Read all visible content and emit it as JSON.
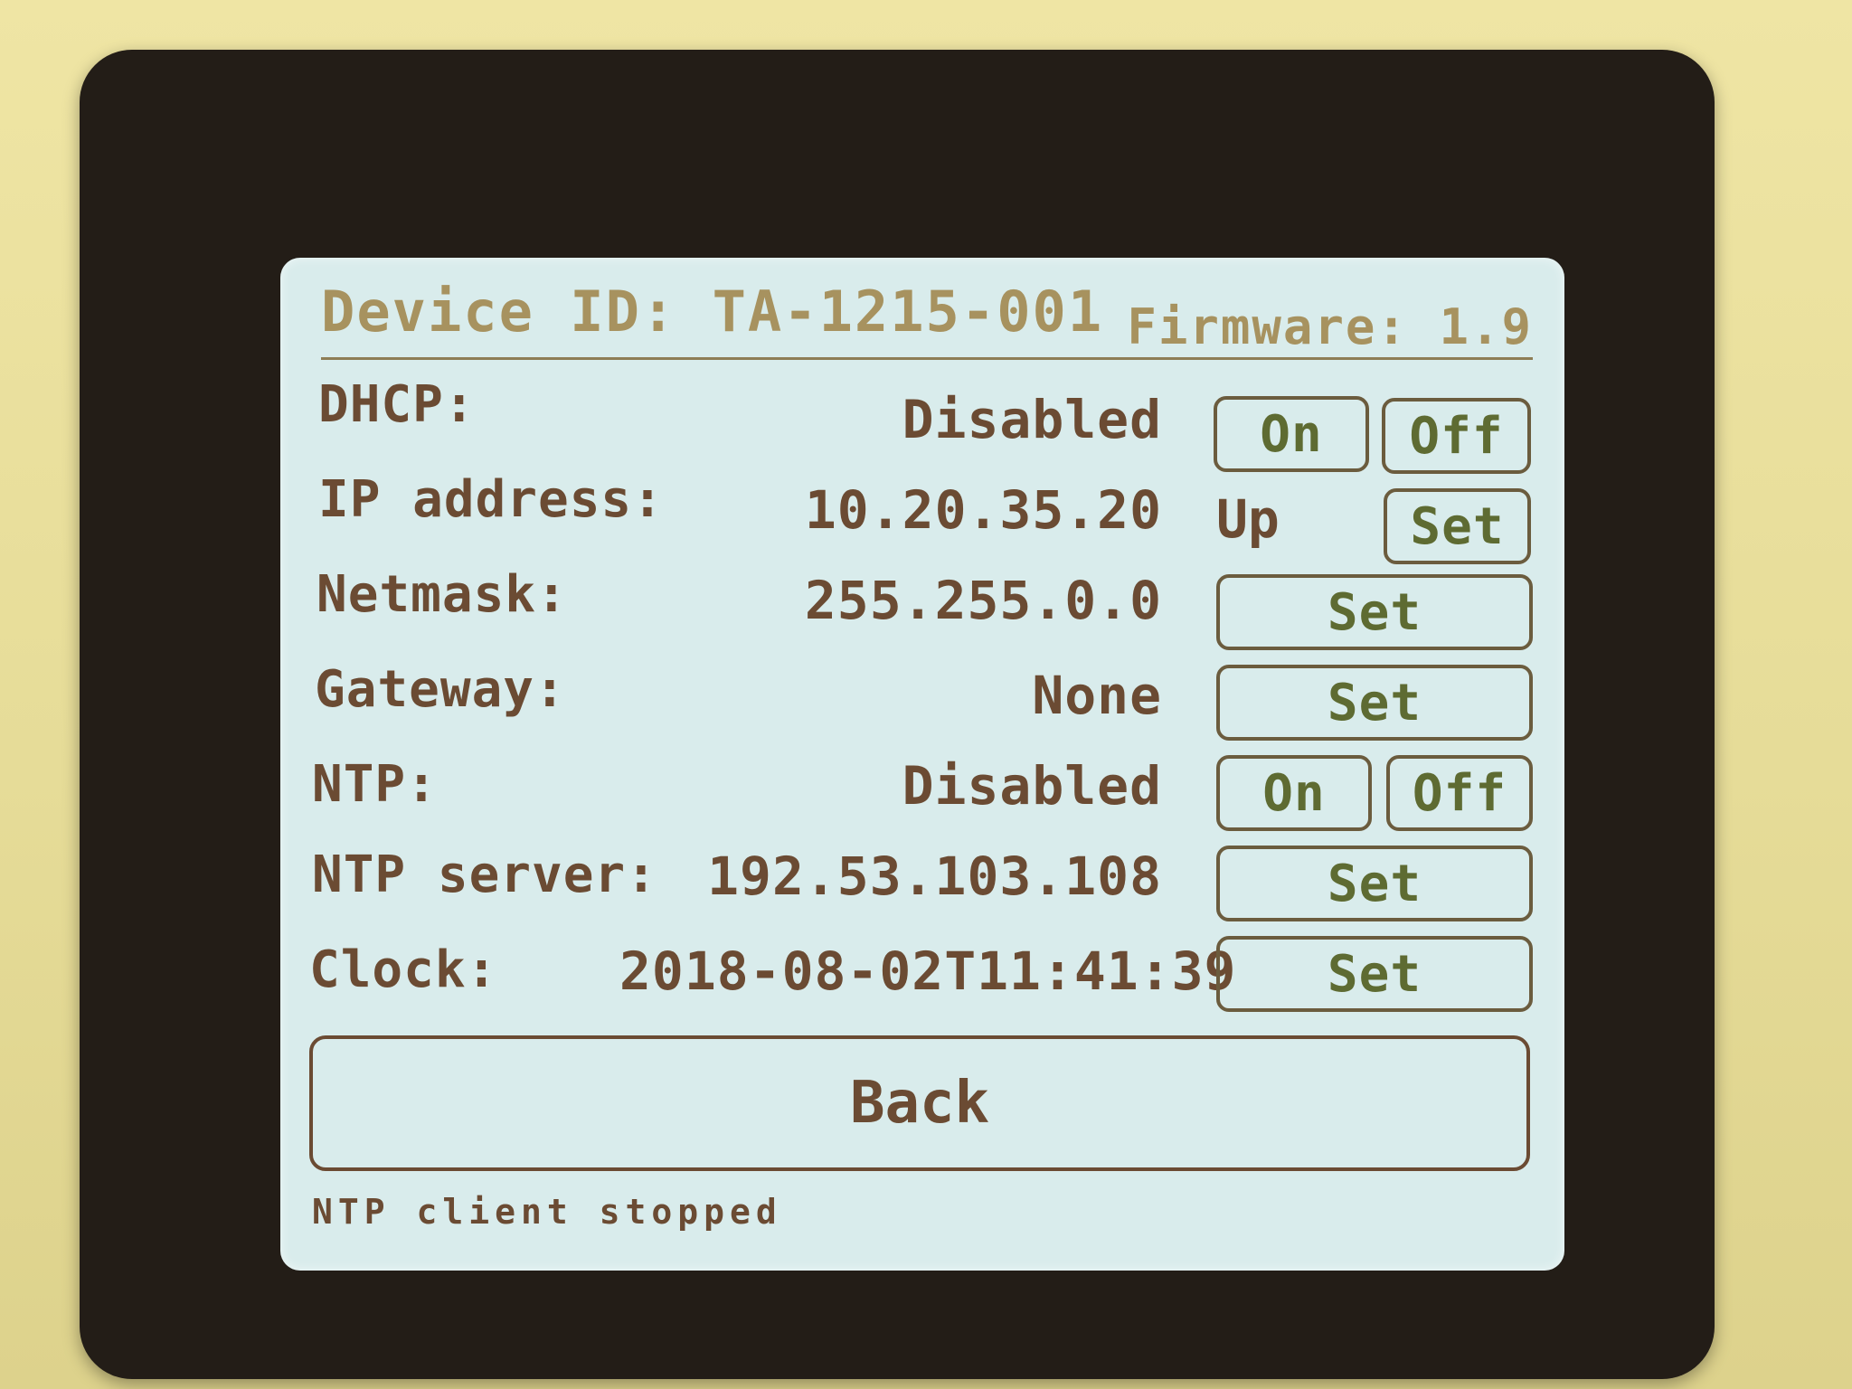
{
  "header": {
    "device_id": "Device ID: TA-1215-001",
    "firmware": "Firmware: 1.9"
  },
  "rows": [
    {
      "label": "DHCP:",
      "value": "Disabled",
      "buttons": [
        "On",
        "Off"
      ]
    },
    {
      "label": "IP address:",
      "value": "10.20.35.20",
      "state": "Up",
      "buttons": [
        "Set"
      ]
    },
    {
      "label": "Netmask:",
      "value": "255.255.0.0",
      "buttons": [
        "Set"
      ]
    },
    {
      "label": "Gateway:",
      "value": "None",
      "buttons": [
        "Set"
      ]
    },
    {
      "label": "NTP:",
      "value": "Disabled",
      "buttons": [
        "On",
        "Off"
      ]
    },
    {
      "label": "NTP server:",
      "value": "192.53.103.108",
      "buttons": [
        "Set"
      ]
    },
    {
      "label": "Clock:",
      "value": "2018-08-02T11:41:39",
      "buttons": [
        "Set"
      ]
    }
  ],
  "back_label": "Back",
  "status_message": "NTP client stopped"
}
